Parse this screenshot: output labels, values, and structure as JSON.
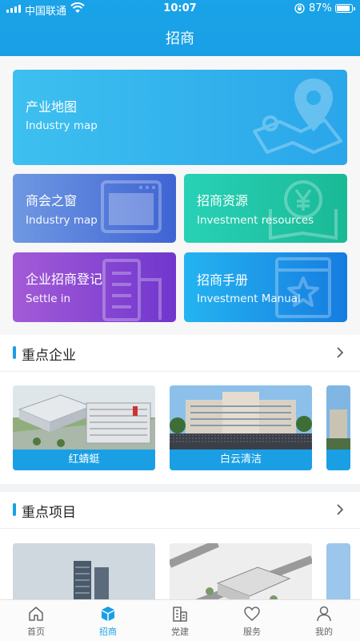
{
  "status": {
    "carrier": "中国联通",
    "time": "10:07",
    "battery": "87%"
  },
  "header": {
    "title": "招商"
  },
  "cards": [
    {
      "cn": "产业地图",
      "en": "Industry map",
      "icon": "map-pin-icon"
    },
    {
      "cn": "商会之窗",
      "en": "Industry map",
      "icon": "browser-window-icon"
    },
    {
      "cn": "招商资源",
      "en": "Investment resources",
      "icon": "yuan-resource-icon"
    },
    {
      "cn": "企业招商登记",
      "en": "Settle in",
      "icon": "building-icon"
    },
    {
      "cn": "招商手册",
      "en": "Investment Manual",
      "icon": "book-star-icon"
    }
  ],
  "sections": [
    {
      "title": "重点企业",
      "items": [
        {
          "caption": "红蜻蜓"
        },
        {
          "caption": "白云清洁"
        }
      ]
    },
    {
      "title": "重点项目",
      "items": []
    }
  ],
  "tabs": [
    {
      "label": "首页",
      "icon": "home-icon",
      "active": false
    },
    {
      "label": "招商",
      "icon": "cube-icon",
      "active": true
    },
    {
      "label": "党建",
      "icon": "party-building-icon",
      "active": false
    },
    {
      "label": "服务",
      "icon": "heart-icon",
      "active": false
    },
    {
      "label": "我的",
      "icon": "user-icon",
      "active": false
    }
  ],
  "colors": {
    "brand": "#1a9fe5",
    "background": "#f2f3f5"
  }
}
